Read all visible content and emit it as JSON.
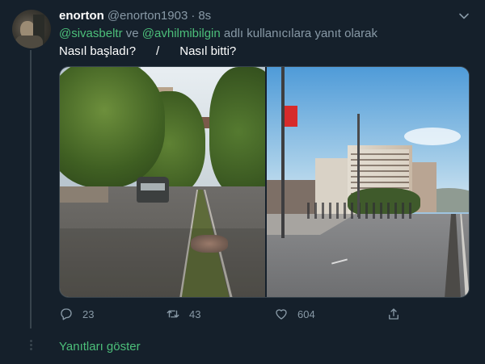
{
  "tweet": {
    "author_name": "enorton",
    "author_handle": "@enorton1903",
    "separator": "·",
    "time": "8s",
    "reply_to": {
      "mention1": "@sivasbeltr",
      "connector": " ve ",
      "mention2": "@avhilmibilgin",
      "suffix": " adlı kullanıcılara yanıt olarak"
    },
    "text": "Nasıl başladı?      /      Nasıl bitti?",
    "media": {
      "left_alt_icon": "photo-street-before",
      "right_alt_icon": "photo-street-after"
    },
    "actions": {
      "reply_count": "23",
      "retweet_count": "43",
      "like_count": "604",
      "share_count": ""
    }
  },
  "show_replies_label": "Yanıtları göster",
  "colors": {
    "background": "#15202b",
    "secondary_text": "#8899a6",
    "accent": "#4cbf7a",
    "border": "#38444d"
  }
}
